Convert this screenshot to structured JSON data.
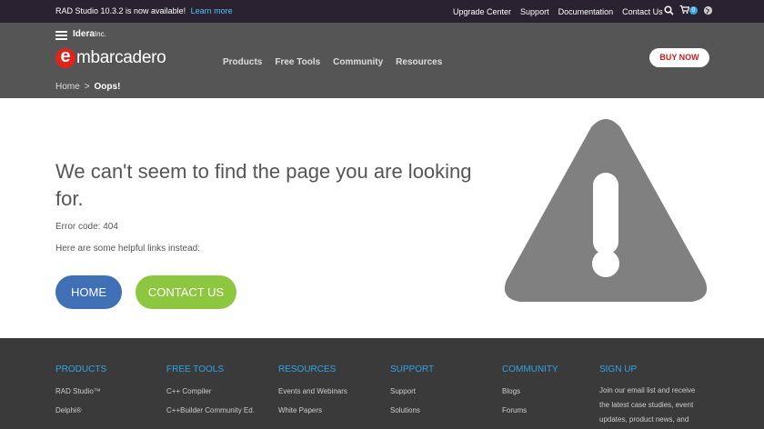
{
  "topbar": {
    "announcement": "RAD Studio 10.3.2 is now available!",
    "learn_more": "Learn more",
    "links": [
      "Upgrade Center",
      "Support",
      "Documentation",
      "Contact Us"
    ],
    "cart_count": "0"
  },
  "header": {
    "idera": "Idera",
    "idera_suffix": "Inc.",
    "logo_letter": "e",
    "logo_word": "mbarcadero",
    "nav": [
      "Products",
      "Free Tools",
      "Community",
      "Resources"
    ],
    "buy_now": "BUY NOW",
    "breadcrumb": {
      "home": "Home",
      "sep": ">",
      "current": "Oops!"
    }
  },
  "main": {
    "headline": "We can't seem to find the page you are looking for.",
    "error_code": "Error code: 404",
    "helpful": "Here are some helpful links instead:",
    "home_button": "HOME",
    "contact_button": "CONTACT US"
  },
  "footer": {
    "products": {
      "heading": "PRODUCTS",
      "items": [
        "RAD Studio™",
        "Delphi®"
      ]
    },
    "free_tools": {
      "heading": "FREE TOOLS",
      "items": [
        "C++ Compiler",
        "C++Builder Community Ed."
      ]
    },
    "resources": {
      "heading": "RESOURCES",
      "items": [
        "Events and Webinars",
        "White Papers"
      ]
    },
    "support": {
      "heading": "SUPPORT",
      "items": [
        "Support",
        "Solutions"
      ]
    },
    "community": {
      "heading": "COMMUNITY",
      "items": [
        "Blogs",
        "Forums"
      ]
    },
    "signup": {
      "heading": "SIGN UP",
      "text": "Join our email list and receive the latest case studies, event updates, product news, and"
    }
  },
  "colors": {
    "accent_blue": "#3f6fb5",
    "accent_green": "#8dc63f",
    "brand_red": "#e2231a",
    "footer_heading": "#2fa4e7"
  }
}
